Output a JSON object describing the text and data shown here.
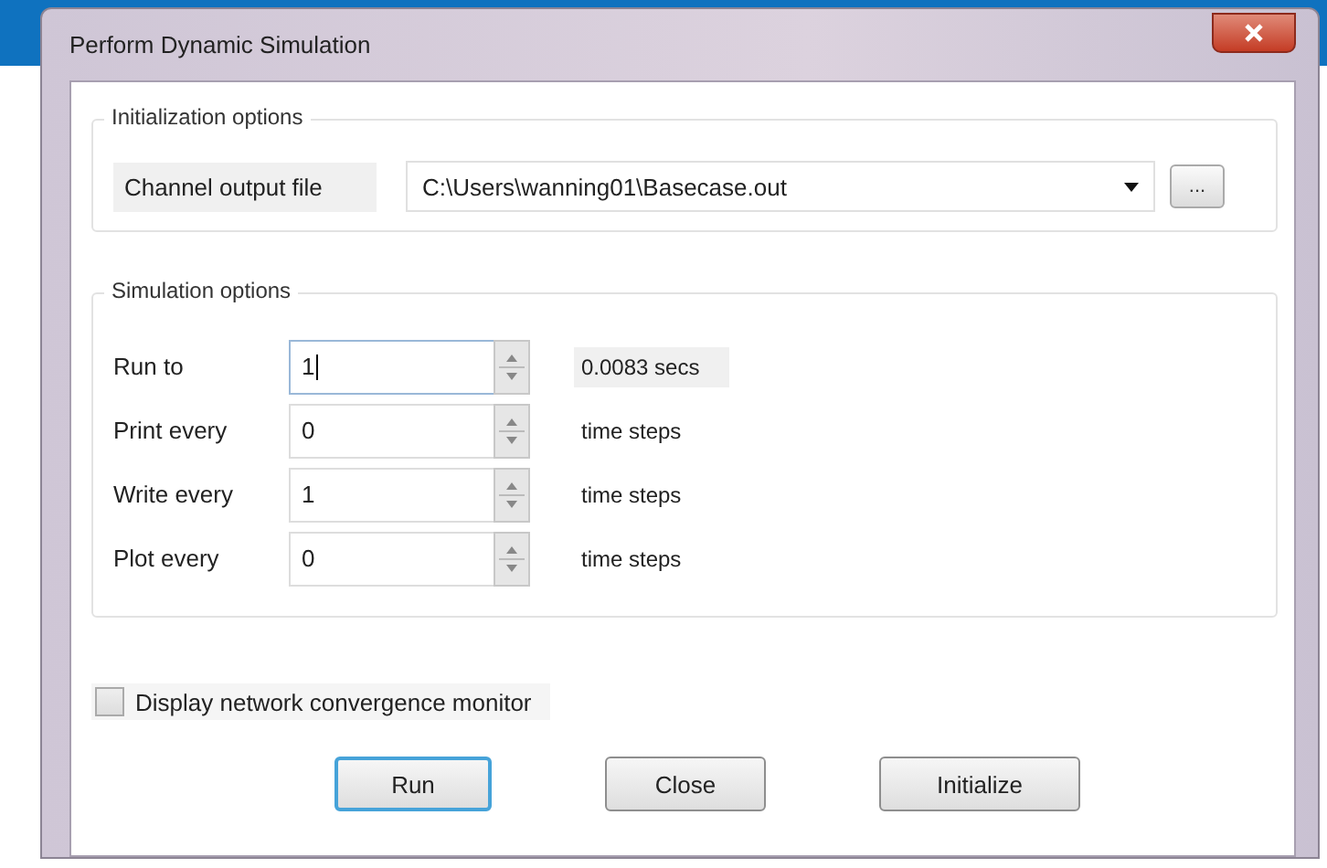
{
  "window": {
    "title": "Perform Dynamic Simulation"
  },
  "initialization_options": {
    "title": "Initialization options",
    "label": "Channel output file",
    "value": "C:\\Users\\wanning01\\Basecase.out",
    "browse_button": "..."
  },
  "simulation_options": {
    "title": "Simulation options",
    "rows": [
      {
        "label": "Run to",
        "value": "1",
        "focused": true,
        "unit": "0.0083 secs",
        "kind": "readout"
      },
      {
        "label": "Print every",
        "value": "0",
        "focused": false,
        "unit": "time steps",
        "kind": "unit"
      },
      {
        "label": "Write every",
        "value": "1",
        "focused": false,
        "unit": "time steps",
        "kind": "unit"
      },
      {
        "label": "Plot every",
        "value": "0",
        "focused": false,
        "unit": "time steps",
        "kind": "unit"
      }
    ]
  },
  "convergence_monitor": {
    "label": "Display network convergence monitor",
    "checked": false
  },
  "buttons": [
    {
      "label": "Run",
      "default": true
    },
    {
      "label": "Close",
      "default": false
    },
    {
      "label": "Initialize",
      "default": false
    }
  ]
}
